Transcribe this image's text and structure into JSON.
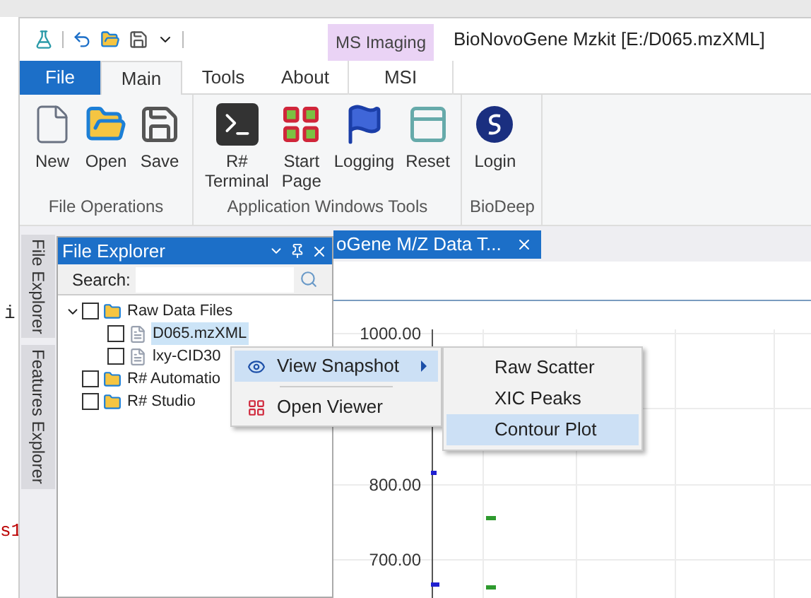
{
  "background_app": {
    "fragments": [
      "i",
      "s1"
    ]
  },
  "window": {
    "title": "BioNovoGene Mzkit [E:/D065.mzXML]",
    "context_group": "MS Imaging"
  },
  "ribbon_tabs": [
    {
      "label": "File",
      "kind": "file",
      "selected": false
    },
    {
      "label": "Main",
      "kind": "tab",
      "selected": true
    },
    {
      "label": "Tools",
      "kind": "tab",
      "selected": false
    },
    {
      "label": "About",
      "kind": "tab",
      "selected": false
    },
    {
      "label": "MSI",
      "kind": "context",
      "selected": false
    }
  ],
  "ribbon_groups": [
    {
      "label": "File Operations",
      "buttons": [
        "New",
        "Open",
        "Save"
      ]
    },
    {
      "label": "Application Windows Tools",
      "buttons": [
        "R#\nTerminal",
        "Start\nPage",
        "Logging",
        "Reset"
      ]
    },
    {
      "label": "BioDeep",
      "buttons": [
        "Login"
      ]
    }
  ],
  "side_tabs": [
    "File Explorer",
    "Features Explorer"
  ],
  "file_explorer": {
    "title": "File Explorer",
    "search_label": "Search:",
    "tree": [
      {
        "label": "Raw Data Files",
        "kind": "folder",
        "checked": false,
        "selected": false,
        "expanded": true,
        "children": [
          {
            "label": "D065.mzXML",
            "kind": "file",
            "checked": false,
            "selected": true
          },
          {
            "label": "lxy-CID30",
            "kind": "file",
            "checked": false,
            "selected": false
          }
        ]
      },
      {
        "label": "R# Automatio",
        "kind": "folder",
        "checked": false,
        "selected": false
      },
      {
        "label": "R# Studio",
        "kind": "folder",
        "checked": false,
        "selected": false
      }
    ]
  },
  "document_tab": {
    "label": "oGene M/Z Data T..."
  },
  "context_menu": [
    {
      "label": "View Snapshot",
      "submenu": true,
      "selected": true
    },
    {
      "label": "Open Viewer",
      "submenu": false,
      "selected": false
    }
  ],
  "submenu": [
    {
      "label": "Raw Scatter",
      "selected": false
    },
    {
      "label": "XIC Peaks",
      "selected": false
    },
    {
      "label": "Contour Plot",
      "selected": true
    }
  ],
  "plot": {
    "y_labels": [
      "1000.00",
      "800.00",
      "700.00"
    ]
  }
}
